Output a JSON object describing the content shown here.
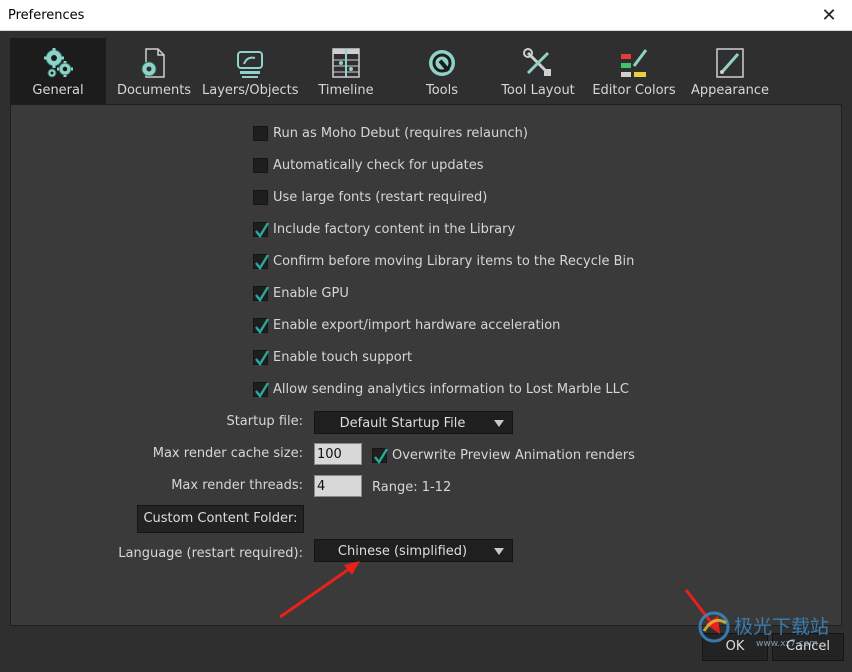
{
  "window": {
    "title": "Preferences",
    "close_glyph": "✕"
  },
  "tabs": [
    {
      "label": "General",
      "icon": "gears-icon",
      "active": true
    },
    {
      "label": "Documents",
      "icon": "document-gear-icon"
    },
    {
      "label": "Layers/Objects",
      "icon": "layers-icon"
    },
    {
      "label": "Timeline",
      "icon": "timeline-icon"
    },
    {
      "label": "Tools",
      "icon": "wrench-circle-icon"
    },
    {
      "label": "Tool Layout",
      "icon": "tools-cross-icon"
    },
    {
      "label": "Editor Colors",
      "icon": "color-swatches-icon"
    },
    {
      "label": "Appearance",
      "icon": "appearance-brush-icon"
    }
  ],
  "general": {
    "checkboxes": [
      {
        "label": "Run as Moho Debut (requires relaunch)",
        "checked": false
      },
      {
        "label": "Automatically check for updates",
        "checked": false
      },
      {
        "label": "Use large fonts (restart required)",
        "checked": false
      },
      {
        "label": "Include factory content in the Library",
        "checked": true
      },
      {
        "label": "Confirm before moving Library items to the Recycle Bin",
        "checked": true
      },
      {
        "label": "Enable GPU",
        "checked": true
      },
      {
        "label": "Enable export/import hardware acceleration",
        "checked": true
      },
      {
        "label": "Enable touch support",
        "checked": true
      },
      {
        "label": "Allow sending analytics information to Lost Marble LLC",
        "checked": true
      }
    ],
    "startup_file": {
      "label": "Startup file:",
      "value": "Default Startup File"
    },
    "max_render_cache": {
      "label": "Max render cache size:",
      "value": "100"
    },
    "overwrite_preview": {
      "label": "Overwrite Preview Animation renders",
      "checked": true
    },
    "max_render_threads": {
      "label": "Max render threads:",
      "value": "4",
      "range": "Range: 1-12"
    },
    "custom_content_button": "Custom Content Folder:",
    "language": {
      "label": "Language (restart required):",
      "value": "Chinese (simplified)"
    }
  },
  "footer": {
    "ok": "OK",
    "cancel": "Cancel"
  },
  "watermark": {
    "text": "极光下载站",
    "url": "www.xz7.com"
  },
  "colors": {
    "accent": "#2aa89a",
    "annotation": "#e8211c",
    "panel": "#3a3a3a",
    "bg": "#2f2f2f"
  }
}
